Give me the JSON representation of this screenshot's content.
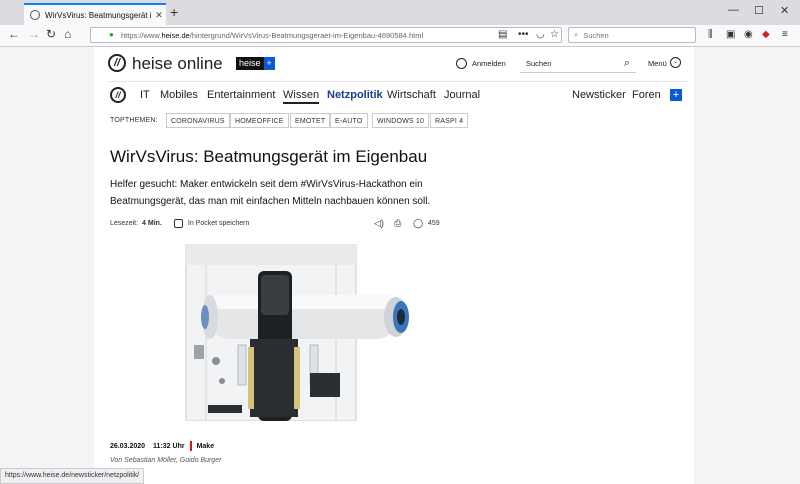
{
  "browser": {
    "tab_title": "WirVsVirus: Beatmungsgerät im",
    "url_host": "heise.de",
    "url_prefix": "https://www.",
    "url_path": "/hintergrund/WirVsVirus-Beatmungsgeraet-im-Eigenbau-4690584.html",
    "search_placeholder": "Suchen",
    "status_url": "https://www.heise.de/newsticker/netzpolitik/"
  },
  "header": {
    "brand": "heise online",
    "plus_text": "heise",
    "plus_sign": "+",
    "login": "Anmelden",
    "search_placeholder": "Suchen",
    "menu": "Menü"
  },
  "nav": {
    "items": [
      "IT",
      "Mobiles",
      "Entertainment",
      "Wissen",
      "Netzpolitik",
      "Wirtschaft",
      "Journal"
    ],
    "right": [
      "Newsticker",
      "Foren"
    ]
  },
  "topthemen": {
    "label": "TOPTHEMEN:",
    "tags": [
      "CORONAVIRUS",
      "HOMEOFFICE",
      "EMOTET",
      "E-AUTO",
      "WINDOWS 10",
      "RASPI 4"
    ]
  },
  "article": {
    "headline": "WirVsVirus: Beatmungsgerät im Eigenbau",
    "teaser": "Helfer gesucht: Maker entwickeln seit dem #WirVsVirus-Hackathon ein Beatmungsgerät, das man mit einfachen Mitteln nachbauen können soll.",
    "reading_label": "Lesezeit:",
    "reading_time": "4 Min.",
    "pocket": "In Pocket speichern",
    "comments": "459",
    "date": "26.03.2020",
    "time": "11:32 Uhr",
    "section": "Make",
    "authors": "Von Sebastian Möller, Guido Burger"
  },
  "colors": {
    "accent_blue": "#0a5ad4",
    "nav_blue": "#1a3d8f",
    "tab_accent": "#0a84ff",
    "section_red": "#dd1111"
  }
}
